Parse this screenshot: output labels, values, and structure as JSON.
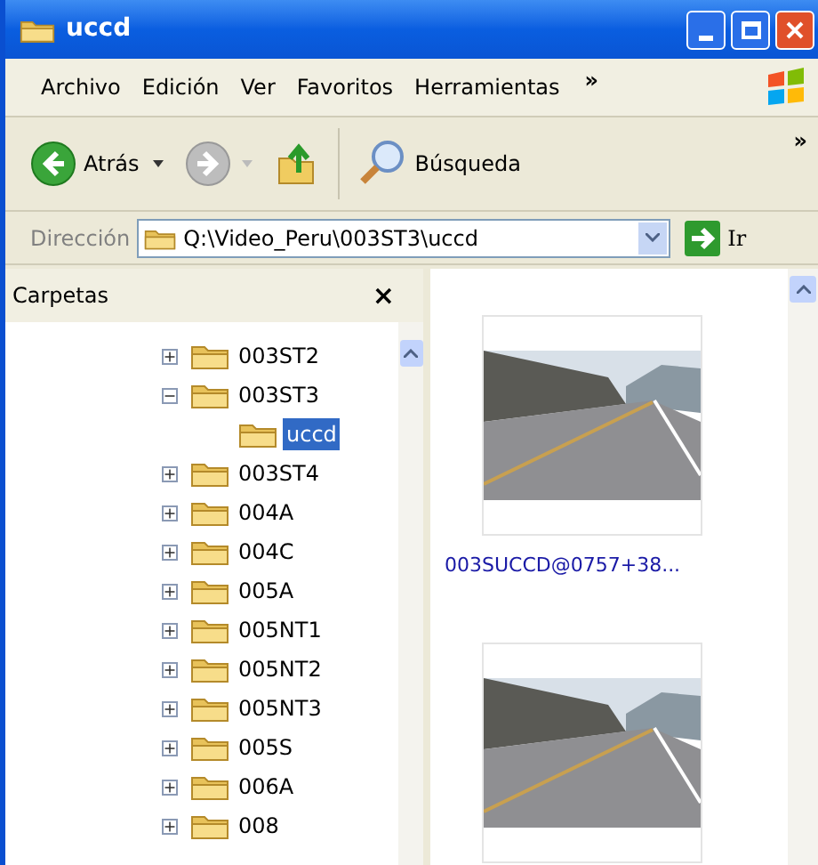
{
  "window": {
    "title": "uccd"
  },
  "menu": [
    "Archivo",
    "Edición",
    "Ver",
    "Favoritos",
    "Herramientas"
  ],
  "menu_overflow": "»",
  "toolbar": {
    "back": "Atrás",
    "search": "Búsqueda",
    "overflow": "»"
  },
  "address": {
    "label": "Dirección",
    "value": "Q:\\Video_Peru\\003ST3\\uccd",
    "go": "Ir"
  },
  "folders_pane": {
    "title": "Carpetas",
    "close": "×",
    "tree": [
      {
        "name": "003ST2",
        "expanded": false,
        "selected": false
      },
      {
        "name": "003ST3",
        "expanded": true,
        "selected": false,
        "children": [
          {
            "name": "uccd",
            "selected": true
          }
        ]
      },
      {
        "name": "003ST4",
        "expanded": false,
        "selected": false
      },
      {
        "name": "004A",
        "expanded": false,
        "selected": false
      },
      {
        "name": "004C",
        "expanded": false,
        "selected": false
      },
      {
        "name": "005A",
        "expanded": false,
        "selected": false
      },
      {
        "name": "005NT1",
        "expanded": false,
        "selected": false
      },
      {
        "name": "005NT2",
        "expanded": false,
        "selected": false
      },
      {
        "name": "005NT3",
        "expanded": false,
        "selected": false
      },
      {
        "name": "005S",
        "expanded": false,
        "selected": false
      },
      {
        "name": "006A",
        "expanded": false,
        "selected": false
      },
      {
        "name": "008",
        "expanded": false,
        "selected": false
      }
    ]
  },
  "files": [
    {
      "kind": "image",
      "name": "003SUCCD@0757+38..."
    },
    {
      "kind": "image"
    }
  ]
}
